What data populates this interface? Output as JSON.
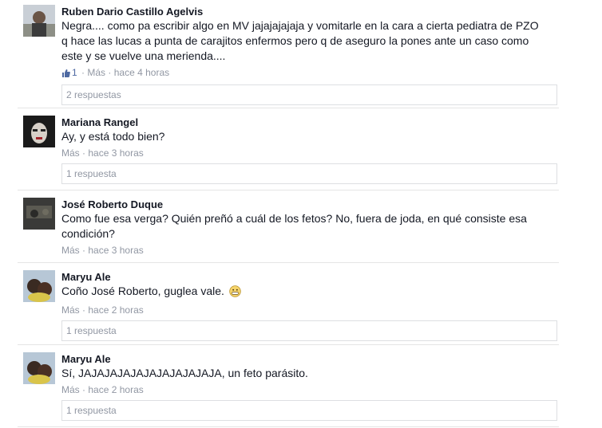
{
  "comments": [
    {
      "author": "Ruben Dario Castillo Agelvis",
      "lines": [
        "Negra.... como pa escribir algo en MV jajajajajaja y vomitarle en la cara a cierta pediatra de PZO",
        "q hace las lucas a punta de carajitos enfermos pero q de aseguro la pones ante un caso como",
        "este y se vuelve una merienda...."
      ],
      "like_count": "1",
      "more": "Más",
      "sep": "·",
      "time": "hace 4 horas",
      "replies": "2 respuestas"
    },
    {
      "author": "Mariana Rangel",
      "lines": [
        "Ay, y está todo bien?"
      ],
      "more": "Más",
      "sep": "·",
      "time": "hace 3 horas",
      "replies": "1 respuesta"
    },
    {
      "author": "José Roberto Duque",
      "lines": [
        "Como fue esa verga? Quién preñó a cuál de los fetos? No, fuera de joda, en qué consiste esa",
        "condición?"
      ],
      "more": "Más",
      "sep": "·",
      "time": "hace 3 horas"
    },
    {
      "author": "Maryu Ale",
      "lines": [
        "Coño José Roberto, guglea vale."
      ],
      "emoji": "grin-emoji",
      "more": "Más",
      "sep": "·",
      "time": "hace 2 horas",
      "replies": "1 respuesta"
    },
    {
      "author": "Maryu Ale",
      "lines": [
        "Sí, JAJAJAJAJAJAJAJAJAJAJA, un feto parásito."
      ],
      "more": "Más",
      "sep": "·",
      "time": "hace 2 horas",
      "replies": "1 respuesta"
    }
  ],
  "colors": {
    "text": "#141823",
    "meta": "#9197a3",
    "like_blue": "#4e69a2",
    "border": "#dddfe2",
    "divider": "#e5e5e5"
  }
}
